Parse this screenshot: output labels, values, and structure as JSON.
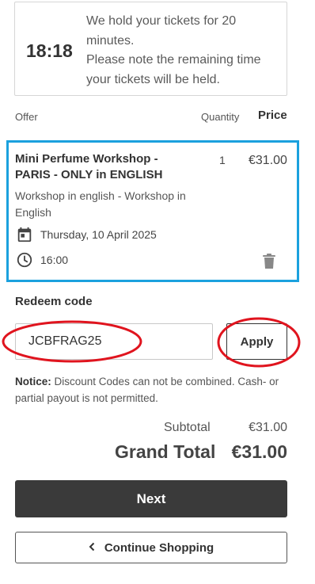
{
  "timer": {
    "value": "18:18",
    "message": "We hold your tickets for 20 minutes.\nPlease note the remaining time your tickets will be held."
  },
  "table_header": {
    "offer": "Offer",
    "quantity": "Quantity",
    "price": "Price"
  },
  "item": {
    "title": "Mini Perfume Workshop - PARIS - ONLY in ENGLISH",
    "quantity": "1",
    "price": "€31.00",
    "description": "Workshop in english - Workshop in English",
    "date": "Thursday, 10 April 2025",
    "time": "16:00",
    "icons": {
      "date": "calendar-icon",
      "time": "clock-icon",
      "delete": "trash-icon"
    }
  },
  "redeem": {
    "title": "Redeem code",
    "code_value": "JCBFRAG25",
    "apply_label": "Apply"
  },
  "notice": {
    "label": "Notice:",
    "text": " Discount Codes can not be combined. Cash- or partial payout is not permitted."
  },
  "totals": {
    "subtotal_label": "Subtotal",
    "subtotal_value": "€31.00",
    "grand_label": "Grand Total",
    "grand_value": "€31.00"
  },
  "actions": {
    "next_label": "Next",
    "continue_label": "Continue Shopping"
  },
  "colors": {
    "highlight_border": "#1ba1de",
    "annotation_red": "#e0141e",
    "primary_button": "#3a3a3a"
  }
}
